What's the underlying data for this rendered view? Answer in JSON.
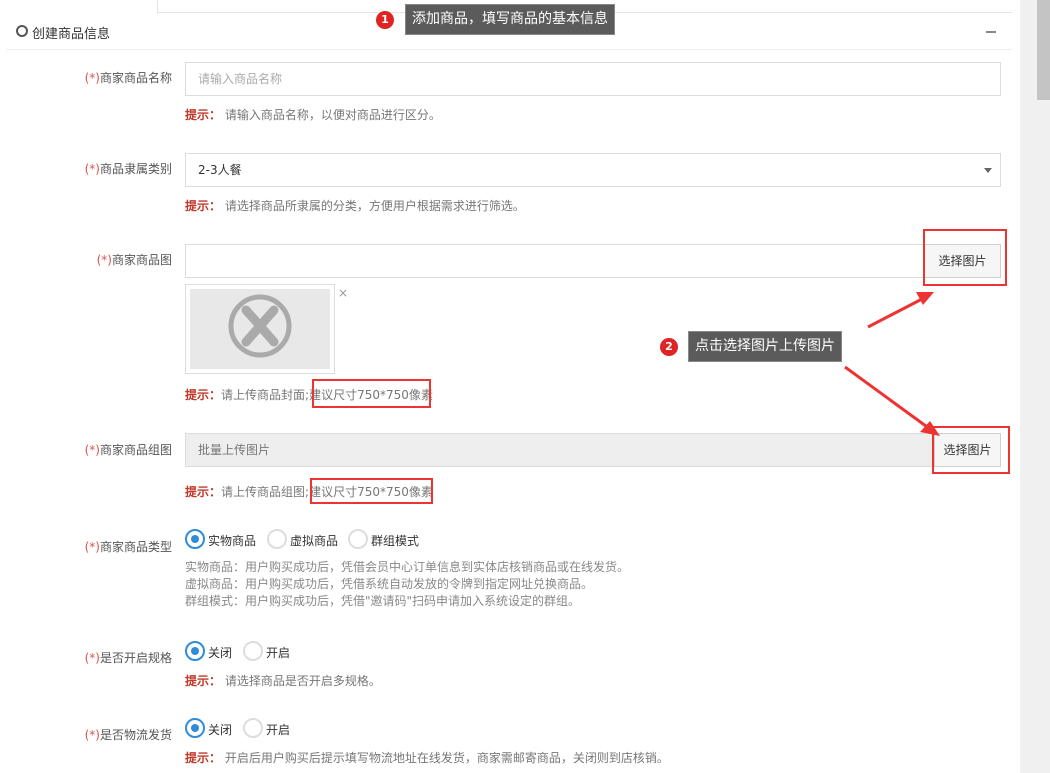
{
  "section": {
    "title": "创建商品信息"
  },
  "fields": {
    "name": {
      "required": "(*)",
      "label": "商家商品名称",
      "placeholder": "请输入商品名称",
      "hint_key": "提示：",
      "hint": "请输入商品名称，以便对商品进行区分。"
    },
    "category": {
      "required": "(*)",
      "label": "商品隶属类别",
      "value": "2-3人餐",
      "hint_key": "提示：",
      "hint": "请选择商品所隶属的分类，方便用户根据需求进行筛选。"
    },
    "cover": {
      "required": "(*)",
      "label": "商家商品图",
      "button": "选择图片",
      "delete": "×",
      "hint_key": "提示：",
      "hint_a": "请上传商品封面;",
      "hint_b": "建议尺寸750*750像素"
    },
    "gallery": {
      "required": "(*)",
      "label": "商家商品组图",
      "placeholder": "批量上传图片",
      "button": "选择图片",
      "hint_key": "提示：",
      "hint_a": "请上传商品组图;",
      "hint_b": "建议尺寸750*750像素"
    },
    "type": {
      "required": "(*)",
      "label": "商家商品类型",
      "options": [
        "实物商品",
        "虚拟商品",
        "群组模式"
      ],
      "selected": "实物商品",
      "desc": [
        "实物商品：用户购买成功后，凭借会员中心订单信息到实体店核销商品或在线发货。",
        "虚拟商品：用户购买成功后，凭借系统自动发放的令牌到指定网址兑换商品。",
        "群组模式：用户购买成功后，凭借\"邀请码\"扫码申请加入系统设定的群组。"
      ]
    },
    "spec": {
      "required": "(*)",
      "label": "是否开启规格",
      "options": [
        "关闭",
        "开启"
      ],
      "selected": "关闭",
      "hint_key": "提示：",
      "hint": "请选择商品是否开启多规格。"
    },
    "shipping": {
      "required": "(*)",
      "label": "是否物流发货",
      "options": [
        "关闭",
        "开启"
      ],
      "selected": "关闭",
      "hint_key": "提示：",
      "hint": "开启后用户购买后提示填写物流地址在线发货，商家需邮寄商品，关闭则到店核销。"
    }
  },
  "annotations": {
    "step1": {
      "number": "1",
      "text": "添加商品，填写商品的基本信息"
    },
    "step2": {
      "number": "2",
      "text": "点击选择图片上传图片"
    }
  },
  "colors": {
    "required": "#d9534f",
    "hint_key": "#c0392b",
    "radio_checked": "#2f8cd8",
    "annotation": "#e33333",
    "callout_bg": "#5b5b5b"
  },
  "icons": {
    "section": "circle-outline-icon",
    "collapse": "minus-icon",
    "placeholder_image": "x-circle-icon",
    "remove": "close-icon",
    "select": "caret-down-icon"
  }
}
